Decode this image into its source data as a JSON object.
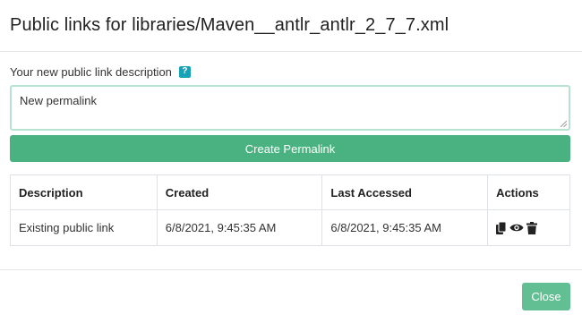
{
  "dialog": {
    "title": "Public links for libraries/Maven__antlr_antlr_2_7_7.xml"
  },
  "form": {
    "label": "Your new public link description",
    "help_icon": "question-mark-icon",
    "help_text": "?",
    "input_value": "New permalink",
    "create_label": "Create Permalink"
  },
  "table": {
    "headers": {
      "description": "Description",
      "created": "Created",
      "last_accessed": "Last Accessed",
      "actions": "Actions"
    },
    "rows": [
      {
        "description": "Existing public link",
        "created": "6/8/2021, 9:45:35 AM",
        "last_accessed": "6/8/2021, 9:45:35 AM",
        "action_icons": [
          "copy-icon",
          "eye-icon",
          "trash-icon"
        ]
      }
    ]
  },
  "footer": {
    "close_label": "Close"
  },
  "colors": {
    "primary": "#4ab281",
    "close_button": "#62bf93",
    "help_badge": "#17a2b8",
    "input_border": "#b8e2d0"
  }
}
